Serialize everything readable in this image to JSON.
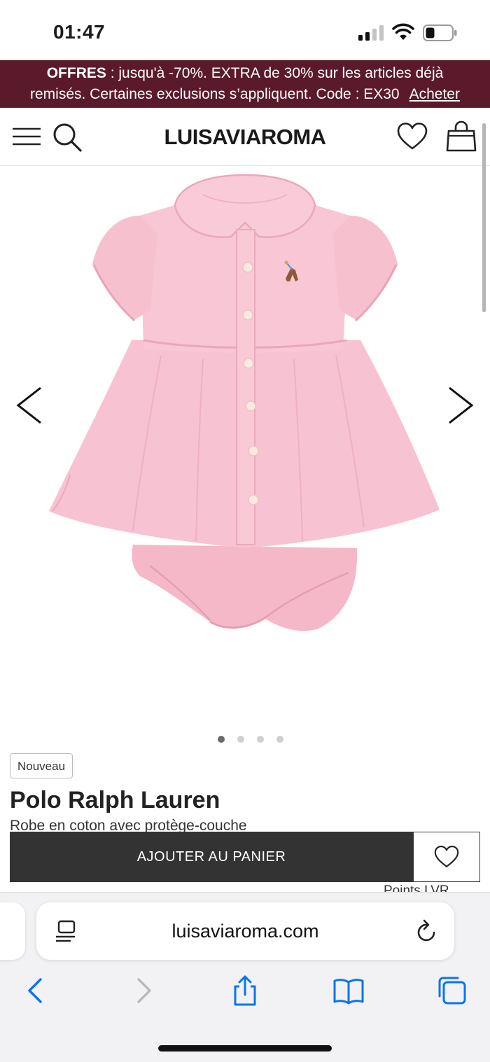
{
  "status_bar": {
    "time": "01:47"
  },
  "promo": {
    "label": "OFFRES",
    "text_line1": " : jusqu'à -70%. EXTRA de 30% sur les articles déjà",
    "text_line2": "remisés. Certaines exclusions s’appliquent. Code : EX30",
    "shop_link": "Acheter",
    "background": "#5a1a2c"
  },
  "header": {
    "logo": "LUISAVIAROMA"
  },
  "gallery": {
    "total_images": 4,
    "active_index": 0
  },
  "product": {
    "badge": "Nouveau",
    "brand": "Polo Ralph Lauren",
    "description": "Robe en coton avec protège-couche",
    "add_to_cart": "AJOUTER AU PANIER",
    "points_text": "Points LVR"
  },
  "safari": {
    "url": "luisaviaroma.com"
  },
  "colors": {
    "dress_pink": "#f6bfcf",
    "button_dark": "#333333",
    "ios_blue": "#0a74f0"
  }
}
